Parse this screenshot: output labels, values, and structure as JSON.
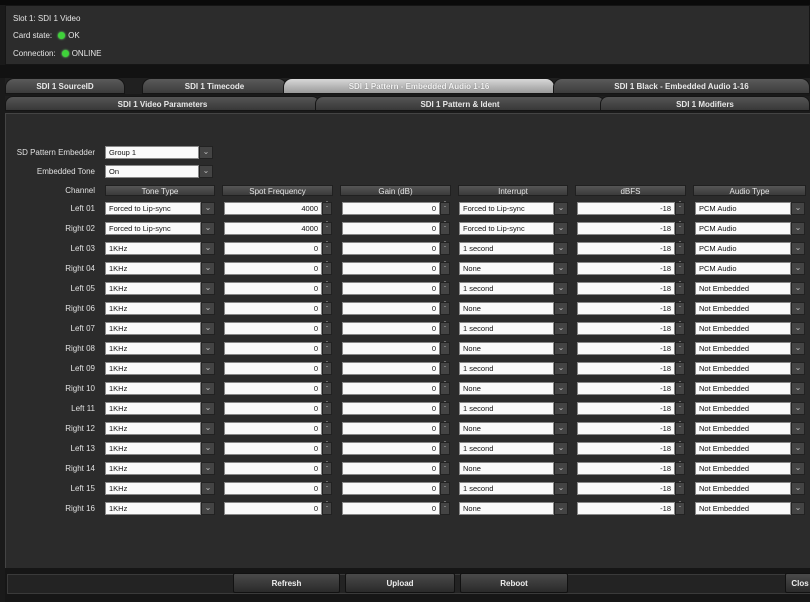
{
  "header": {
    "slot_title": "Slot 1: SDI 1 Video",
    "card_state_label": "Card state:",
    "card_state_value": "OK",
    "connection_label": "Connection:",
    "connection_value": "ONLINE",
    "status_color": "#3fd23a"
  },
  "tabs": [
    {
      "label": "SDI 1 SourceID",
      "active": false
    },
    {
      "label": "SDI 1 Timecode",
      "active": false
    },
    {
      "label": "SDI 1 Pattern - Embedded Audio 1-16",
      "active": true
    },
    {
      "label": "SDI 1 Black - Embedded Audio 1-16",
      "active": false
    }
  ],
  "subtabs": [
    {
      "label": "SDI 1 Video Parameters"
    },
    {
      "label": "SDI 1 Pattern & Ident"
    },
    {
      "label": "SDI 1 Modifiers"
    }
  ],
  "form": {
    "pattern_embedder_label": "SD Pattern Embedder",
    "pattern_embedder_value": "Group 1",
    "embedded_tone_label": "Embedded Tone",
    "embedded_tone_value": "On"
  },
  "table": {
    "channel_header": "Channel",
    "columns": [
      "Tone Type",
      "Spot Frequency",
      "Gain (dB)",
      "Interrupt",
      "dBFS",
      "Audio Type"
    ],
    "rows": [
      {
        "channel": "Left 01",
        "tone": "Forced to Lip-sync",
        "freq": "4000",
        "gain": "0",
        "interrupt": "Forced to Lip-sync",
        "dbfs": "-18",
        "audio": "PCM Audio"
      },
      {
        "channel": "Right 02",
        "tone": "Forced to Lip-sync",
        "freq": "4000",
        "gain": "0",
        "interrupt": "Forced to Lip-sync",
        "dbfs": "-18",
        "audio": "PCM Audio"
      },
      {
        "channel": "Left 03",
        "tone": "1KHz",
        "freq": "0",
        "gain": "0",
        "interrupt": "1 second",
        "dbfs": "-18",
        "audio": "PCM Audio"
      },
      {
        "channel": "Right 04",
        "tone": "1KHz",
        "freq": "0",
        "gain": "0",
        "interrupt": "None",
        "dbfs": "-18",
        "audio": "PCM Audio"
      },
      {
        "channel": "Left 05",
        "tone": "1KHz",
        "freq": "0",
        "gain": "0",
        "interrupt": "1 second",
        "dbfs": "-18",
        "audio": "Not Embedded"
      },
      {
        "channel": "Right 06",
        "tone": "1KHz",
        "freq": "0",
        "gain": "0",
        "interrupt": "None",
        "dbfs": "-18",
        "audio": "Not Embedded"
      },
      {
        "channel": "Left 07",
        "tone": "1KHz",
        "freq": "0",
        "gain": "0",
        "interrupt": "1 second",
        "dbfs": "-18",
        "audio": "Not Embedded"
      },
      {
        "channel": "Right 08",
        "tone": "1KHz",
        "freq": "0",
        "gain": "0",
        "interrupt": "None",
        "dbfs": "-18",
        "audio": "Not Embedded"
      },
      {
        "channel": "Left 09",
        "tone": "1KHz",
        "freq": "0",
        "gain": "0",
        "interrupt": "1 second",
        "dbfs": "-18",
        "audio": "Not Embedded"
      },
      {
        "channel": "Right 10",
        "tone": "1KHz",
        "freq": "0",
        "gain": "0",
        "interrupt": "None",
        "dbfs": "-18",
        "audio": "Not Embedded"
      },
      {
        "channel": "Left 11",
        "tone": "1KHz",
        "freq": "0",
        "gain": "0",
        "interrupt": "1 second",
        "dbfs": "-18",
        "audio": "Not Embedded"
      },
      {
        "channel": "Right 12",
        "tone": "1KHz",
        "freq": "0",
        "gain": "0",
        "interrupt": "None",
        "dbfs": "-18",
        "audio": "Not Embedded"
      },
      {
        "channel": "Left 13",
        "tone": "1KHz",
        "freq": "0",
        "gain": "0",
        "interrupt": "1 second",
        "dbfs": "-18",
        "audio": "Not Embedded"
      },
      {
        "channel": "Right 14",
        "tone": "1KHz",
        "freq": "0",
        "gain": "0",
        "interrupt": "None",
        "dbfs": "-18",
        "audio": "Not Embedded"
      },
      {
        "channel": "Left 15",
        "tone": "1KHz",
        "freq": "0",
        "gain": "0",
        "interrupt": "1 second",
        "dbfs": "-18",
        "audio": "Not Embedded"
      },
      {
        "channel": "Right 16",
        "tone": "1KHz",
        "freq": "0",
        "gain": "0",
        "interrupt": "None",
        "dbfs": "-18",
        "audio": "Not Embedded"
      }
    ]
  },
  "footer": {
    "refresh_label": "Refresh",
    "upload_label": "Upload",
    "reboot_label": "Reboot",
    "close_label": "Clos"
  }
}
